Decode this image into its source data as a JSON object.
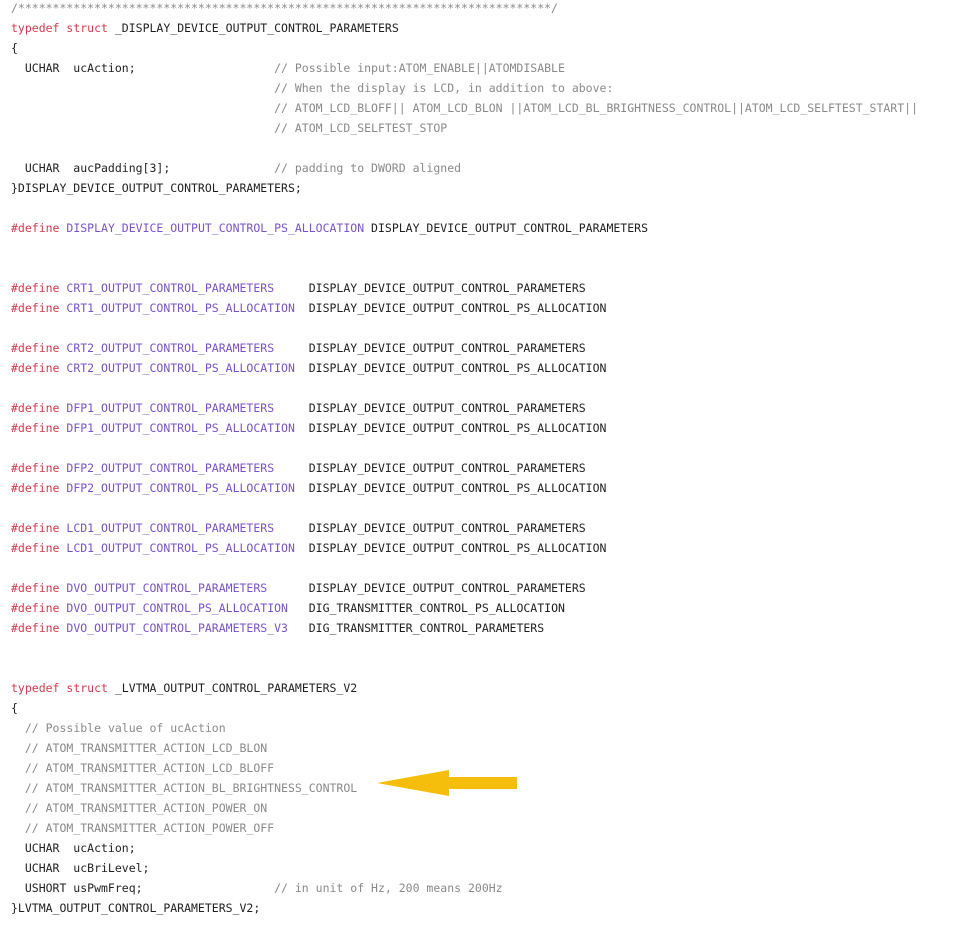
{
  "code_lines": [
    {
      "spans": [
        {
          "t": "cm",
          "v": "/*****************************************************************************/"
        }
      ]
    },
    {
      "spans": [
        {
          "t": "kw",
          "v": "typedef"
        },
        {
          "t": "tx",
          "v": " "
        },
        {
          "t": "kw",
          "v": "struct"
        },
        {
          "t": "tx",
          "v": " _DISPLAY_DEVICE_OUTPUT_CONTROL_PARAMETERS"
        }
      ]
    },
    {
      "spans": [
        {
          "t": "tx",
          "v": "{"
        }
      ]
    },
    {
      "spans": [
        {
          "t": "tx",
          "v": "  UCHAR  ucAction;                    "
        },
        {
          "t": "cm",
          "v": "// Possible input:ATOM_ENABLE||ATOMDISABLE"
        }
      ]
    },
    {
      "spans": [
        {
          "t": "tx",
          "v": "                                      "
        },
        {
          "t": "cm",
          "v": "// When the display is LCD, in addition to above:"
        }
      ]
    },
    {
      "spans": [
        {
          "t": "tx",
          "v": "                                      "
        },
        {
          "t": "cm",
          "v": "// ATOM_LCD_BLOFF|| ATOM_LCD_BLON ||ATOM_LCD_BL_BRIGHTNESS_CONTROL||ATOM_LCD_SELFTEST_START||"
        }
      ]
    },
    {
      "spans": [
        {
          "t": "tx",
          "v": "                                      "
        },
        {
          "t": "cm",
          "v": "// ATOM_LCD_SELFTEST_STOP"
        }
      ]
    },
    {
      "spans": []
    },
    {
      "spans": [
        {
          "t": "tx",
          "v": "  UCHAR  aucPadding[3];               "
        },
        {
          "t": "cm",
          "v": "// padding to DWORD aligned"
        }
      ]
    },
    {
      "spans": [
        {
          "t": "tx",
          "v": "}DISPLAY_DEVICE_OUTPUT_CONTROL_PARAMETERS;"
        }
      ]
    },
    {
      "spans": []
    },
    {
      "spans": [
        {
          "t": "kw",
          "v": "#define"
        },
        {
          "t": "tx",
          "v": " "
        },
        {
          "t": "mac",
          "v": "DISPLAY_DEVICE_OUTPUT_CONTROL_PS_ALLOCATION"
        },
        {
          "t": "tx",
          "v": " DISPLAY_DEVICE_OUTPUT_CONTROL_PARAMETERS"
        }
      ]
    },
    {
      "spans": []
    },
    {
      "spans": []
    },
    {
      "spans": [
        {
          "t": "kw",
          "v": "#define"
        },
        {
          "t": "tx",
          "v": " "
        },
        {
          "t": "mac",
          "v": "CRT1_OUTPUT_CONTROL_PARAMETERS"
        },
        {
          "t": "tx",
          "v": "     DISPLAY_DEVICE_OUTPUT_CONTROL_PARAMETERS"
        }
      ]
    },
    {
      "spans": [
        {
          "t": "kw",
          "v": "#define"
        },
        {
          "t": "tx",
          "v": " "
        },
        {
          "t": "mac",
          "v": "CRT1_OUTPUT_CONTROL_PS_ALLOCATION"
        },
        {
          "t": "tx",
          "v": "  DISPLAY_DEVICE_OUTPUT_CONTROL_PS_ALLOCATION"
        }
      ]
    },
    {
      "spans": []
    },
    {
      "spans": [
        {
          "t": "kw",
          "v": "#define"
        },
        {
          "t": "tx",
          "v": " "
        },
        {
          "t": "mac",
          "v": "CRT2_OUTPUT_CONTROL_PARAMETERS"
        },
        {
          "t": "tx",
          "v": "     DISPLAY_DEVICE_OUTPUT_CONTROL_PARAMETERS"
        }
      ]
    },
    {
      "spans": [
        {
          "t": "kw",
          "v": "#define"
        },
        {
          "t": "tx",
          "v": " "
        },
        {
          "t": "mac",
          "v": "CRT2_OUTPUT_CONTROL_PS_ALLOCATION"
        },
        {
          "t": "tx",
          "v": "  DISPLAY_DEVICE_OUTPUT_CONTROL_PS_ALLOCATION"
        }
      ]
    },
    {
      "spans": []
    },
    {
      "spans": [
        {
          "t": "kw",
          "v": "#define"
        },
        {
          "t": "tx",
          "v": " "
        },
        {
          "t": "mac",
          "v": "DFP1_OUTPUT_CONTROL_PARAMETERS"
        },
        {
          "t": "tx",
          "v": "     DISPLAY_DEVICE_OUTPUT_CONTROL_PARAMETERS"
        }
      ]
    },
    {
      "spans": [
        {
          "t": "kw",
          "v": "#define"
        },
        {
          "t": "tx",
          "v": " "
        },
        {
          "t": "mac",
          "v": "DFP1_OUTPUT_CONTROL_PS_ALLOCATION"
        },
        {
          "t": "tx",
          "v": "  DISPLAY_DEVICE_OUTPUT_CONTROL_PS_ALLOCATION"
        }
      ]
    },
    {
      "spans": []
    },
    {
      "spans": [
        {
          "t": "kw",
          "v": "#define"
        },
        {
          "t": "tx",
          "v": " "
        },
        {
          "t": "mac",
          "v": "DFP2_OUTPUT_CONTROL_PARAMETERS"
        },
        {
          "t": "tx",
          "v": "     DISPLAY_DEVICE_OUTPUT_CONTROL_PARAMETERS"
        }
      ]
    },
    {
      "spans": [
        {
          "t": "kw",
          "v": "#define"
        },
        {
          "t": "tx",
          "v": " "
        },
        {
          "t": "mac",
          "v": "DFP2_OUTPUT_CONTROL_PS_ALLOCATION"
        },
        {
          "t": "tx",
          "v": "  DISPLAY_DEVICE_OUTPUT_CONTROL_PS_ALLOCATION"
        }
      ]
    },
    {
      "spans": []
    },
    {
      "spans": [
        {
          "t": "kw",
          "v": "#define"
        },
        {
          "t": "tx",
          "v": " "
        },
        {
          "t": "mac",
          "v": "LCD1_OUTPUT_CONTROL_PARAMETERS"
        },
        {
          "t": "tx",
          "v": "     DISPLAY_DEVICE_OUTPUT_CONTROL_PARAMETERS"
        }
      ]
    },
    {
      "spans": [
        {
          "t": "kw",
          "v": "#define"
        },
        {
          "t": "tx",
          "v": " "
        },
        {
          "t": "mac",
          "v": "LCD1_OUTPUT_CONTROL_PS_ALLOCATION"
        },
        {
          "t": "tx",
          "v": "  DISPLAY_DEVICE_OUTPUT_CONTROL_PS_ALLOCATION"
        }
      ]
    },
    {
      "spans": []
    },
    {
      "spans": [
        {
          "t": "kw",
          "v": "#define"
        },
        {
          "t": "tx",
          "v": " "
        },
        {
          "t": "mac",
          "v": "DVO_OUTPUT_CONTROL_PARAMETERS"
        },
        {
          "t": "tx",
          "v": "      DISPLAY_DEVICE_OUTPUT_CONTROL_PARAMETERS"
        }
      ]
    },
    {
      "spans": [
        {
          "t": "kw",
          "v": "#define"
        },
        {
          "t": "tx",
          "v": " "
        },
        {
          "t": "mac",
          "v": "DVO_OUTPUT_CONTROL_PS_ALLOCATION"
        },
        {
          "t": "tx",
          "v": "   DIG_TRANSMITTER_CONTROL_PS_ALLOCATION"
        }
      ]
    },
    {
      "spans": [
        {
          "t": "kw",
          "v": "#define"
        },
        {
          "t": "tx",
          "v": " "
        },
        {
          "t": "mac",
          "v": "DVO_OUTPUT_CONTROL_PARAMETERS_V3"
        },
        {
          "t": "tx",
          "v": "   DIG_TRANSMITTER_CONTROL_PARAMETERS"
        }
      ]
    },
    {
      "spans": []
    },
    {
      "spans": []
    },
    {
      "spans": [
        {
          "t": "kw",
          "v": "typedef"
        },
        {
          "t": "tx",
          "v": " "
        },
        {
          "t": "kw",
          "v": "struct"
        },
        {
          "t": "tx",
          "v": " _LVTMA_OUTPUT_CONTROL_PARAMETERS_V2"
        }
      ]
    },
    {
      "spans": [
        {
          "t": "tx",
          "v": "{"
        }
      ]
    },
    {
      "spans": [
        {
          "t": "tx",
          "v": "  "
        },
        {
          "t": "cm",
          "v": "// Possible value of ucAction"
        }
      ]
    },
    {
      "spans": [
        {
          "t": "tx",
          "v": "  "
        },
        {
          "t": "cm",
          "v": "// ATOM_TRANSMITTER_ACTION_LCD_BLON"
        }
      ]
    },
    {
      "spans": [
        {
          "t": "tx",
          "v": "  "
        },
        {
          "t": "cm",
          "v": "// ATOM_TRANSMITTER_ACTION_LCD_BLOFF"
        }
      ]
    },
    {
      "spans": [
        {
          "t": "tx",
          "v": "  "
        },
        {
          "t": "cm",
          "v": "// ATOM_TRANSMITTER_ACTION_BL_BRIGHTNESS_CONTROL"
        }
      ]
    },
    {
      "spans": [
        {
          "t": "tx",
          "v": "  "
        },
        {
          "t": "cm",
          "v": "// ATOM_TRANSMITTER_ACTION_POWER_ON"
        }
      ]
    },
    {
      "spans": [
        {
          "t": "tx",
          "v": "  "
        },
        {
          "t": "cm",
          "v": "// ATOM_TRANSMITTER_ACTION_POWER_OFF"
        }
      ]
    },
    {
      "spans": [
        {
          "t": "tx",
          "v": "  UCHAR  ucAction;"
        }
      ]
    },
    {
      "spans": [
        {
          "t": "tx",
          "v": "  UCHAR  ucBriLevel;"
        }
      ]
    },
    {
      "spans": [
        {
          "t": "tx",
          "v": "  USHORT usPwmFreq;                   "
        },
        {
          "t": "cm",
          "v": "// in unit of Hz, 200 means 200Hz"
        }
      ]
    },
    {
      "spans": [
        {
          "t": "tx",
          "v": "}LVTMA_OUTPUT_CONTROL_PARAMETERS_V2;"
        }
      ]
    }
  ],
  "colors": {
    "keyword": "#d73a49",
    "macro": "#7a52c9",
    "comment": "#8a8a8a",
    "text": "#1f1f1f",
    "arrow": "#f5bd0c"
  },
  "annotation": {
    "icon": "left-arrow-icon"
  }
}
